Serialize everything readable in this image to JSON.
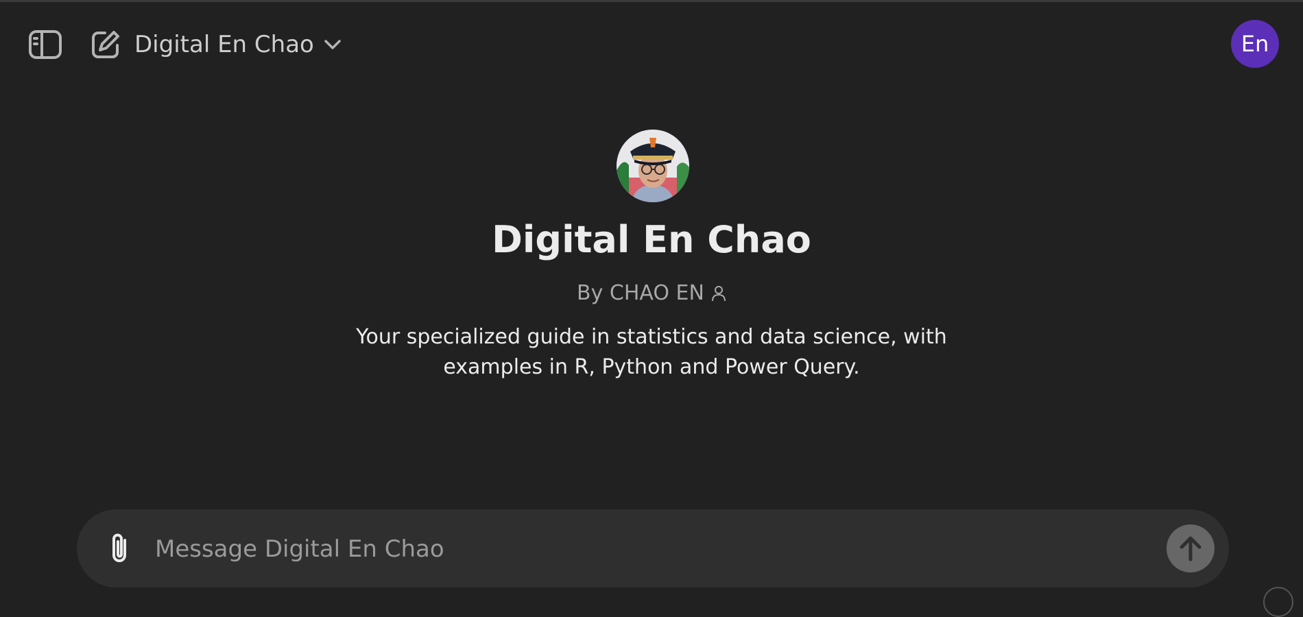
{
  "header": {
    "model_name": "Digital En Chao",
    "user_initials": "En"
  },
  "gpt": {
    "title": "Digital En Chao",
    "byline": "By CHAO EN",
    "description": "Your specialized guide in statistics and data science, with examples in R, Python and Power Query."
  },
  "composer": {
    "placeholder": "Message Digital En Chao"
  },
  "colors": {
    "background": "#212121",
    "composer": "#2f2f2f",
    "user_avatar": "#5b2fb7",
    "send_button": "#676767"
  },
  "icons": [
    "sidebar-toggle-icon",
    "new-chat-icon",
    "chevron-down-icon",
    "person-icon",
    "paperclip-icon",
    "arrow-up-icon"
  ]
}
